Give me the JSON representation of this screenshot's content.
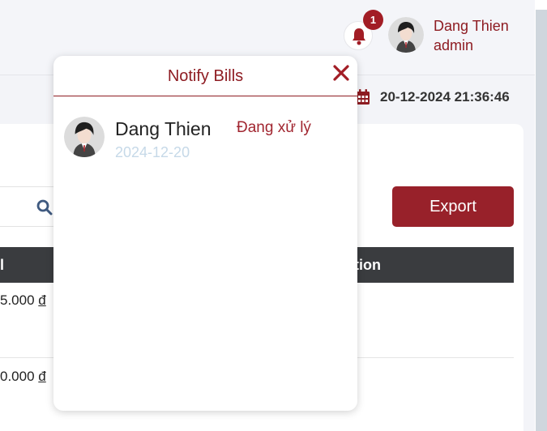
{
  "header": {
    "notification_count": "1",
    "user_name": "Dang Thien",
    "user_role": "admin",
    "datetime": "20-12-2024 21:36:46"
  },
  "toolbar": {
    "export_label": "Export"
  },
  "table": {
    "header_left": "l",
    "header_right": "tion",
    "rows": [
      {
        "price": "5.000",
        "currency": "đ"
      },
      {
        "price": "0.000",
        "currency": "đ"
      }
    ]
  },
  "notify": {
    "title": "Notify Bills",
    "items": [
      {
        "name": "Dang Thien",
        "date": "2024-12-20",
        "status": "Đang xử lý"
      }
    ]
  },
  "colors": {
    "brand": "#8e1c22",
    "badge": "#a21d25",
    "export": "#98212a",
    "table_header": "#3a3c3f",
    "date_text": "#c6d9e8"
  },
  "icons": [
    "bell-icon",
    "calendar-icon",
    "search-icon",
    "close-icon",
    "avatar"
  ]
}
